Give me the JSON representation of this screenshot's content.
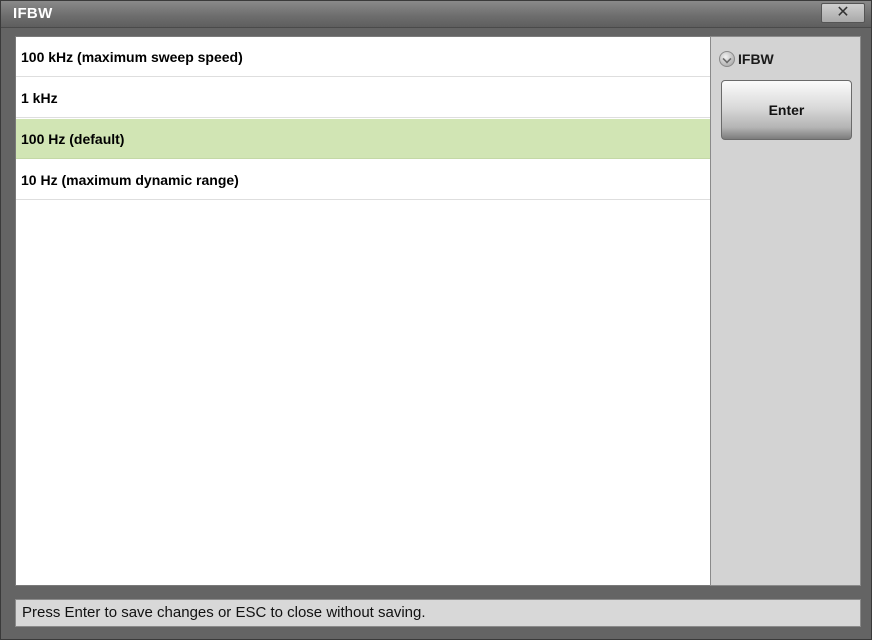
{
  "window": {
    "title": "IFBW",
    "close_symbol": "✕"
  },
  "list": {
    "items": [
      {
        "label": "100 kHz (maximum sweep speed)",
        "selected": false
      },
      {
        "label": "1 kHz",
        "selected": false
      },
      {
        "label": "100 Hz (default)",
        "selected": true
      },
      {
        "label": "10 Hz (maximum dynamic range)",
        "selected": false
      }
    ]
  },
  "side_panel": {
    "section_label": "IFBW",
    "section_icon": "chevron-down-icon",
    "enter_label": "Enter"
  },
  "status": {
    "message": "Press Enter to save changes or ESC to close without saving."
  },
  "colors": {
    "selected_row": "#d1e5b4",
    "titlebar": "#6e6e6e",
    "panel": "#d3d3d3"
  }
}
